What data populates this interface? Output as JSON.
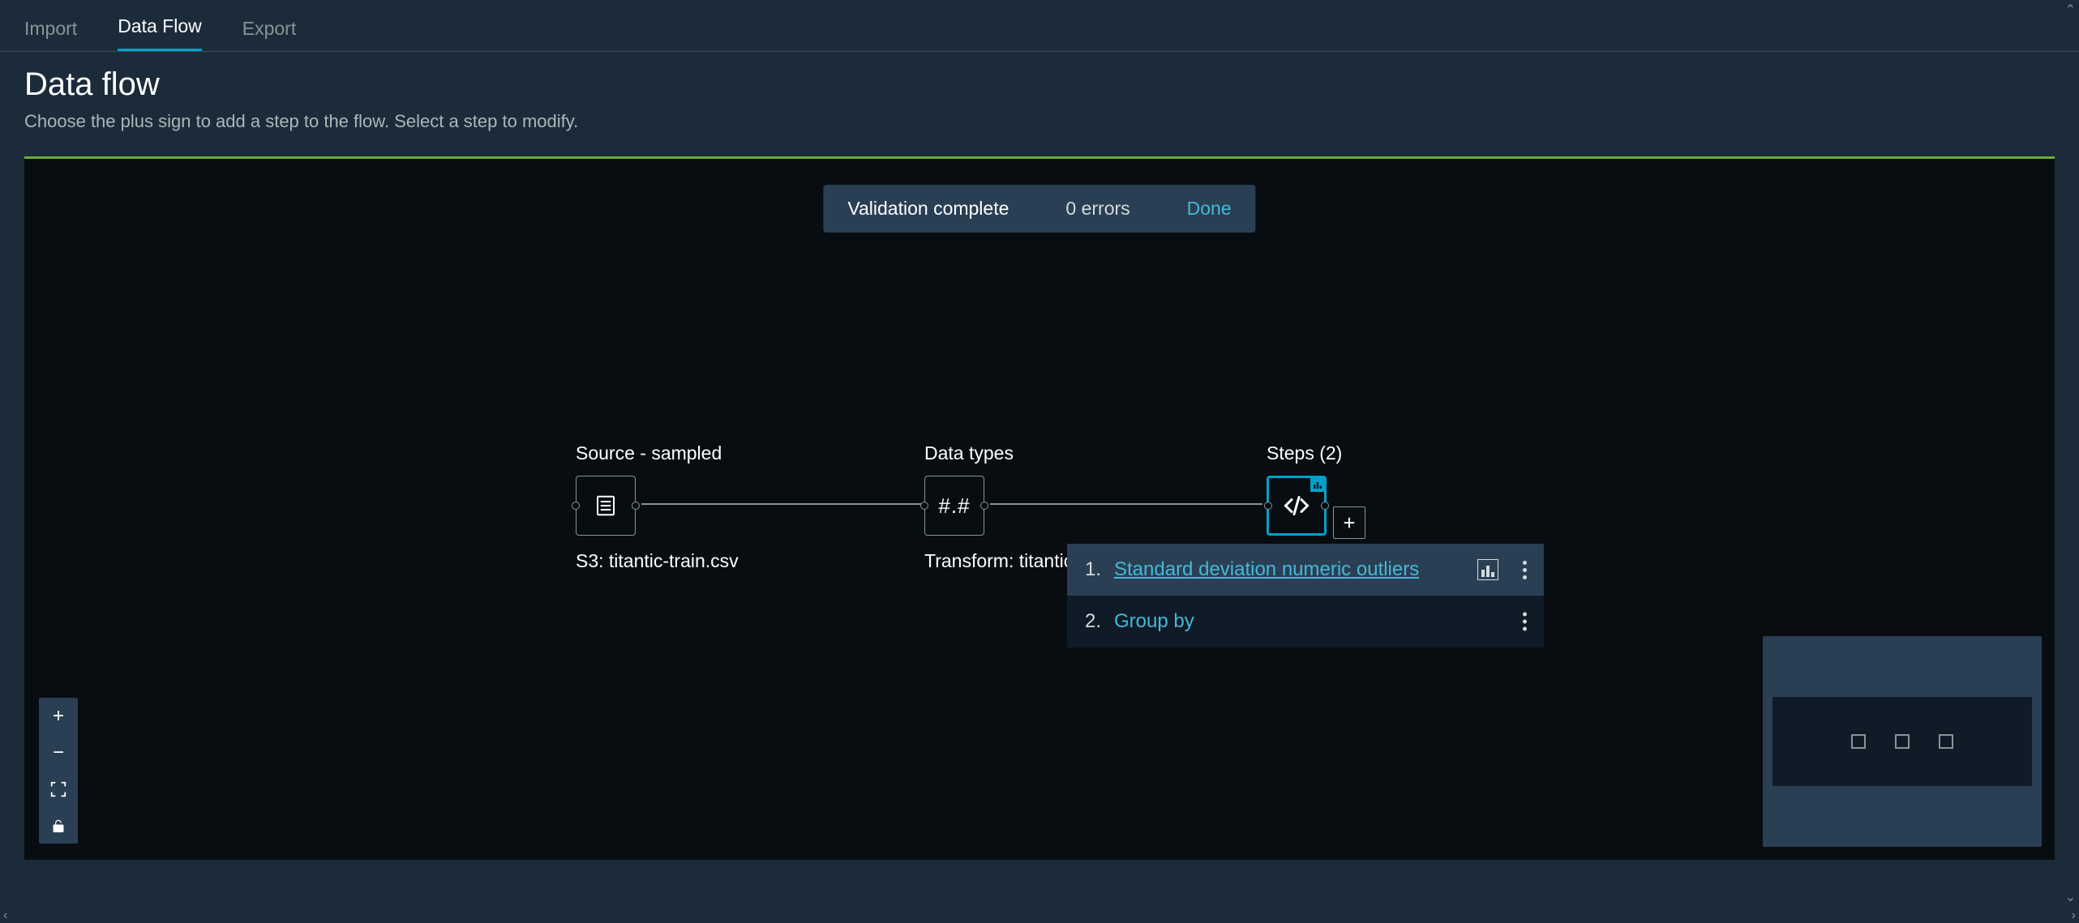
{
  "tabs": {
    "import": "Import",
    "data_flow": "Data Flow",
    "export": "Export"
  },
  "header": {
    "title": "Data flow",
    "subtitle": "Choose the plus sign to add a step to the flow. Select a step to modify."
  },
  "toast": {
    "message": "Validation complete",
    "errors": "0 errors",
    "done": "Done"
  },
  "nodes": {
    "source": {
      "title": "Source - sampled",
      "subtitle": "S3: titantic-train.csv",
      "icon_label": "file"
    },
    "datatypes": {
      "title": "Data types",
      "subtitle": "Transform: titantic",
      "symbol": "#.#"
    },
    "steps": {
      "title": "Steps (2)",
      "add_label": "+"
    }
  },
  "popover": {
    "items": [
      {
        "num": "1.",
        "label": "Standard deviation numeric outliers",
        "has_chart": true
      },
      {
        "num": "2.",
        "label": "Group by",
        "has_chart": false
      }
    ]
  },
  "zoom": {
    "in": "+",
    "out": "−"
  }
}
